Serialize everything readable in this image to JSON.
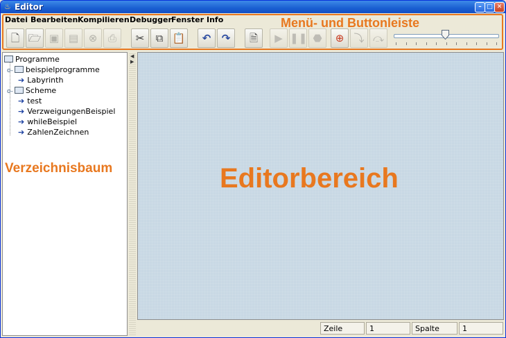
{
  "window": {
    "title": "Editor",
    "controls": [
      "minimize",
      "maximize",
      "close"
    ]
  },
  "menubar": {
    "items": [
      "Datei",
      "Bearbeiten",
      "Kompilieren",
      "Debugger",
      "Fenster",
      "Info"
    ]
  },
  "toolbar": {
    "buttons": [
      {
        "name": "new-file-button",
        "icon": "new-file-icon",
        "enabled": true
      },
      {
        "name": "open-folder-button",
        "icon": "open-folder-icon",
        "enabled": true
      },
      {
        "name": "save-button",
        "icon": "save-icon",
        "enabled": false
      },
      {
        "name": "save-all-button",
        "icon": "save-all-icon",
        "enabled": false
      },
      {
        "name": "close-file-button",
        "icon": "close-file-icon",
        "enabled": false
      },
      {
        "name": "print-button",
        "icon": "print-icon",
        "enabled": false
      },
      {
        "name": "cut-button",
        "icon": "scissors-icon",
        "enabled": true
      },
      {
        "name": "copy-button",
        "icon": "copy-icon",
        "enabled": true
      },
      {
        "name": "paste-button",
        "icon": "clipboard-icon",
        "enabled": true
      },
      {
        "name": "undo-button",
        "icon": "undo-icon",
        "enabled": true
      },
      {
        "name": "redo-button",
        "icon": "redo-icon",
        "enabled": true
      },
      {
        "name": "compile-button",
        "icon": "binary-file-icon",
        "enabled": true
      },
      {
        "name": "run-button",
        "icon": "play-icon",
        "enabled": false
      },
      {
        "name": "pause-button",
        "icon": "pause-icon",
        "enabled": false
      },
      {
        "name": "stop-button",
        "icon": "stop-icon",
        "enabled": false
      },
      {
        "name": "debug-target-button",
        "icon": "target-icon",
        "enabled": true
      },
      {
        "name": "step-into-button",
        "icon": "step-into-icon",
        "enabled": false
      },
      {
        "name": "step-over-button",
        "icon": "step-over-icon",
        "enabled": false
      }
    ],
    "speed_slider": {
      "value_fraction": 0.49,
      "ticks": 11
    }
  },
  "tree": {
    "root": "Programme",
    "items": [
      {
        "label": "beispielprogramme",
        "type": "folder"
      },
      {
        "label": "Labyrinth",
        "type": "program"
      },
      {
        "label": "Scheme",
        "type": "folder"
      },
      {
        "label": "test",
        "type": "program"
      },
      {
        "label": "VerzweigungenBeispiel",
        "type": "program"
      },
      {
        "label": "whileBeispiel",
        "type": "program"
      },
      {
        "label": "ZahlenZeichnen",
        "type": "program"
      }
    ]
  },
  "annotations": {
    "toolbar_area": "Menü- und Buttonleiste",
    "tree_area": "Verzeichnisbaum",
    "editor_area": "Editorbereich"
  },
  "statusbar": {
    "line_label": "Zeile",
    "line_value": "1",
    "column_label": "Spalte",
    "column_value": "1"
  },
  "colors": {
    "annotation": "#e8781f",
    "titlebar": "#1a5fd1",
    "editor_background": "#c8d8e4"
  }
}
